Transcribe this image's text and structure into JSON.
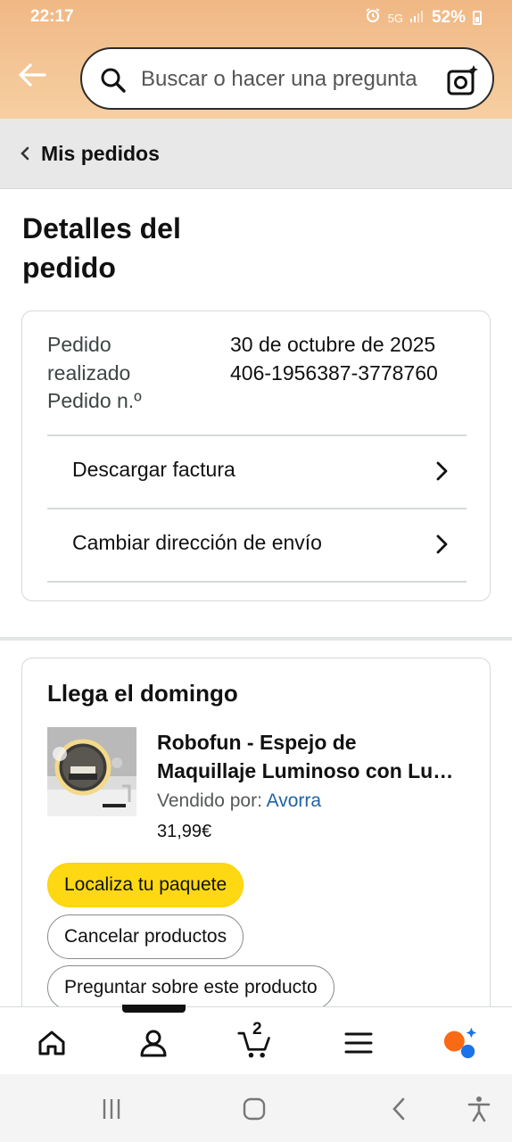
{
  "status_bar": {
    "time": "22:17",
    "network": "5G",
    "battery": "52%"
  },
  "header": {
    "search_placeholder": "Buscar o hacer una pregunta"
  },
  "breadcrumb": {
    "label": "Mis pedidos"
  },
  "page": {
    "title": "Detalles del pedido"
  },
  "order_info": {
    "date_label": "Pedido realizado",
    "date_value": "30 de octubre de 2025",
    "number_label": "Pedido n.º",
    "number_value": "406-1956387-3778760",
    "links": [
      {
        "label": "Descargar factura"
      },
      {
        "label": "Cambiar dirección de envío"
      }
    ]
  },
  "shipment": {
    "arrival": "Llega el domingo",
    "product": {
      "name": "Robofun - Espejo de Maquillaje Luminoso con Luz LED",
      "seller_label": "Vendido por:",
      "seller_name": "Avorra",
      "price": "31,99€"
    },
    "buttons": {
      "track": "Localiza tu paquete",
      "cancel": "Cancelar productos",
      "ask": "Preguntar sobre este producto"
    }
  },
  "bottom_nav": {
    "cart_count": "2",
    "items": [
      "home-icon",
      "account-icon",
      "cart-icon",
      "menu-icon",
      "rufus-icon"
    ]
  },
  "colors": {
    "header_gradient": "#f0b885",
    "primary_button": "#ffd814",
    "link": "#2162a1"
  }
}
